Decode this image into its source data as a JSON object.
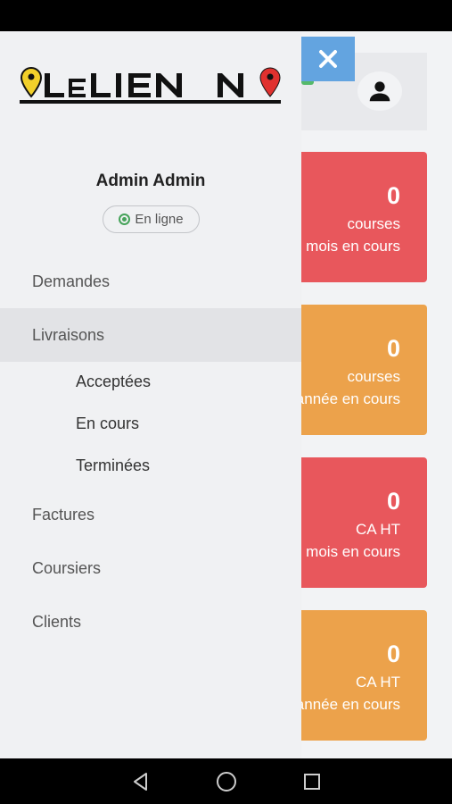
{
  "header": {
    "close_icon": "close-icon",
    "profile_icon": "user-icon"
  },
  "drawer": {
    "logo_text": "LeLien",
    "admin_name": "Admin Admin",
    "status_label": "En ligne",
    "menu": [
      {
        "label": "Demandes",
        "active": false
      },
      {
        "label": "Livraisons",
        "active": true
      },
      {
        "label": "Factures",
        "active": false
      },
      {
        "label": "Coursiers",
        "active": false
      },
      {
        "label": "Clients",
        "active": false
      }
    ],
    "submenu": [
      {
        "label": "Acceptées"
      },
      {
        "label": "En cours"
      },
      {
        "label": "Terminées"
      }
    ]
  },
  "cards": [
    {
      "value": "0",
      "label": "courses",
      "sub": "mois en cours",
      "color": "#e8575c"
    },
    {
      "value": "0",
      "label": "courses",
      "sub": "année en cours",
      "color": "#eca24b"
    },
    {
      "value": "0",
      "label": "CA HT",
      "sub": "mois en cours",
      "color": "#e8575c"
    },
    {
      "value": "0",
      "label": "CA HT",
      "sub": "année en cours",
      "color": "#eca24b"
    }
  ],
  "colors": {
    "accent_blue": "#63a4e0",
    "online_green": "#46a35a",
    "pin_yellow": "#f2d02a",
    "pin_red": "#e0312f"
  },
  "system_nav": {
    "back_icon": "back-triangle-icon",
    "home_icon": "home-circle-icon",
    "recents_icon": "recents-square-icon"
  }
}
